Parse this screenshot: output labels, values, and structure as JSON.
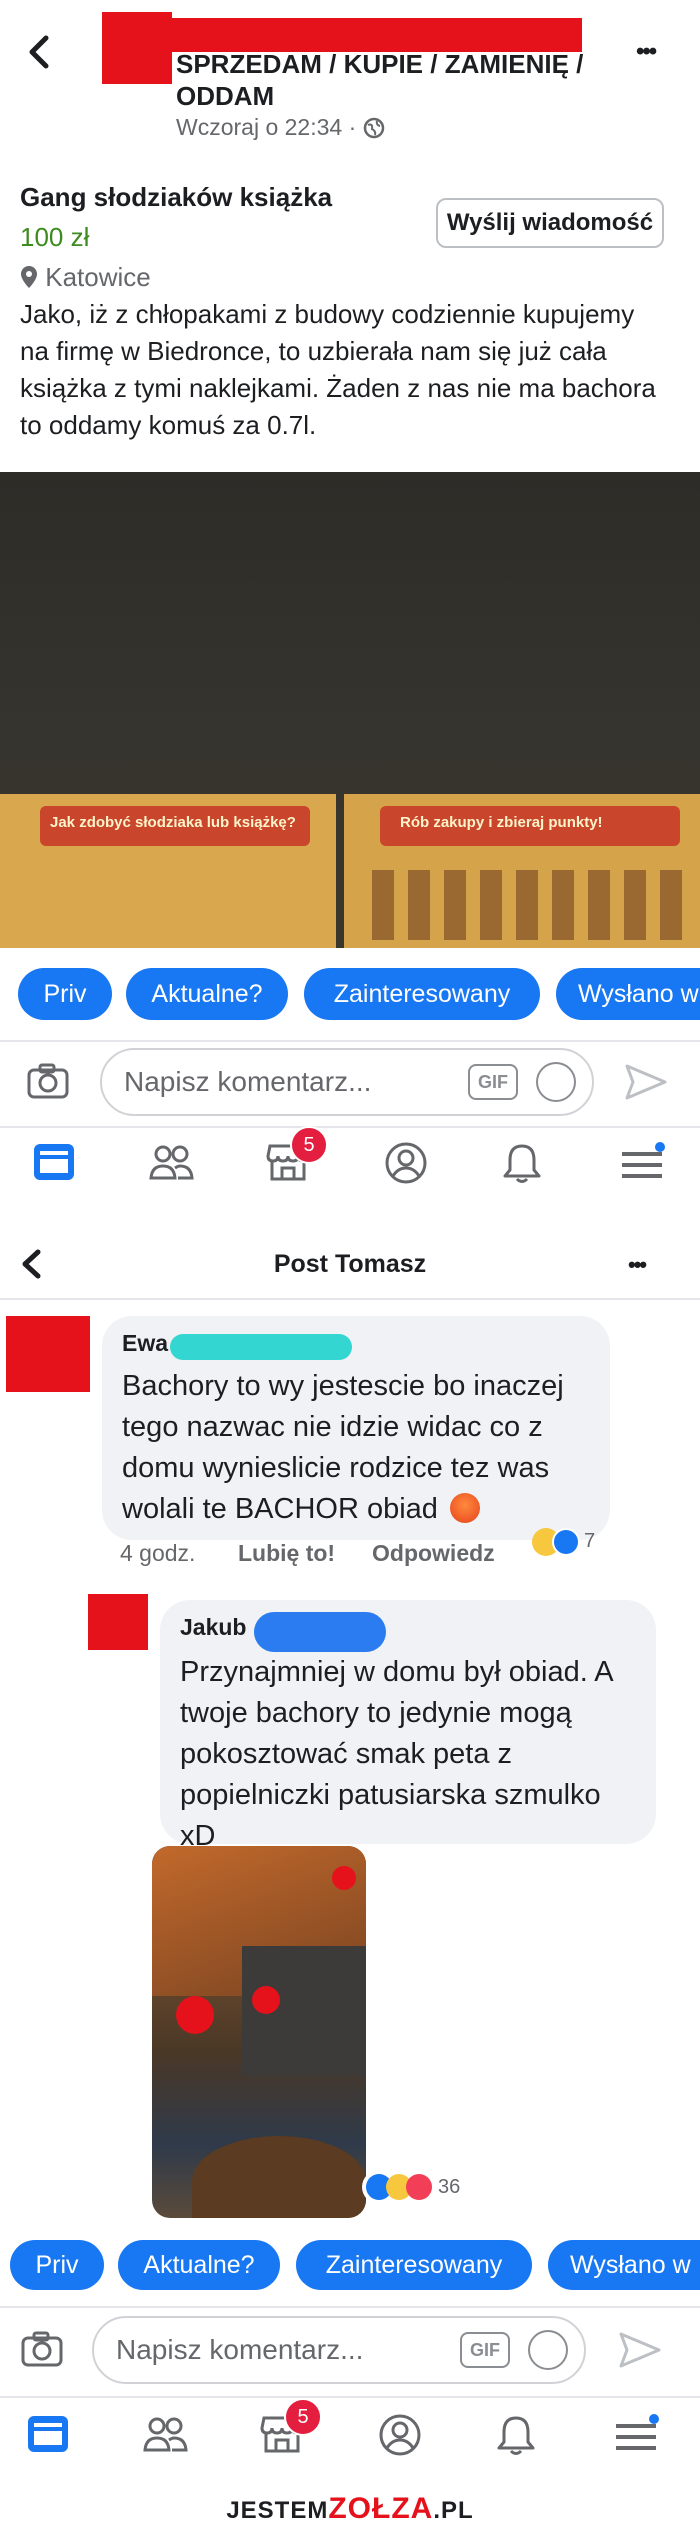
{
  "top": {
    "group_name": "SPRZEDAM / KUPIE / ZAMIENIĘ / ODDAM",
    "timestamp": "Wczoraj o 22:34 ·",
    "more": "•••"
  },
  "listing": {
    "title": "Gang słodziaków książka",
    "price": "100 zł",
    "location": "Katowice",
    "send_message": "Wyślij wiadomość",
    "description": "Jako, iż z chłopakami z budowy codziennie kupujemy na firmę w Biedronce, to uzbierała nam się już cała książka z tymi naklejkami. Żaden z nas nie ma bachora to oddamy komuś za 0.7l.",
    "photo_text_left": "Jak zdobyć słodziaka lub książkę?",
    "photo_text_right": "Rób zakupy i zbieraj punkty!"
  },
  "chips": [
    "Priv",
    "Aktualne?",
    "Zainteresowany",
    "Wysłano w"
  ],
  "comment_box": {
    "placeholder": "Napisz komentarz...",
    "gif": "GIF"
  },
  "nav": {
    "badge": "5"
  },
  "post_header": {
    "title": "Post Tomasz",
    "more": "•••"
  },
  "comments": [
    {
      "author": "Ewa",
      "text": "Bachory to wy jestescie bo inaczej tego nazwac nie idzie widac co z domu wynieslicie rodzice tez was wolali te BACHOR obiad",
      "time": "4 godz.",
      "like": "Lubię to!",
      "reply": "Odpowiedz",
      "reactions": "7"
    },
    {
      "author": "Jakub",
      "text": "Przynajmniej w domu był obiad. A twoje bachory to jedynie mogą pokosztować smak peta z popielniczki patusiarska szmulko xD",
      "reactions": "36"
    }
  ],
  "footer": {
    "brand_a": "JESTEM",
    "brand_b": "ZOŁZA",
    "brand_c": ".PL"
  },
  "colors": {
    "fb_blue": "#1877f2",
    "redaction": "#e5121c",
    "cyan_scribble": "#33d6d0",
    "blue_scribble": "#2a7cf0"
  }
}
